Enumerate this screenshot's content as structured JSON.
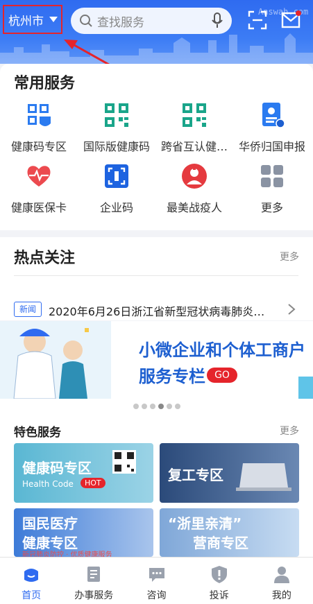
{
  "header": {
    "city": "杭州市",
    "search_placeholder": "查找服务",
    "watermark": "Answah.com"
  },
  "common_services": {
    "title": "常用服务",
    "items": [
      {
        "label": "健康码专区",
        "icon": "health-code-icon"
      },
      {
        "label": "国际版健康码",
        "icon": "qr-code-icon"
      },
      {
        "label": "跨省互认健…",
        "icon": "qr-code-icon"
      },
      {
        "label": "华侨归国申报",
        "icon": "id-card-icon"
      },
      {
        "label": "健康医保卡",
        "icon": "heart-icon"
      },
      {
        "label": "企业码",
        "icon": "enterprise-code-icon"
      },
      {
        "label": "最美战疫人",
        "icon": "medic-icon"
      },
      {
        "label": "更多",
        "icon": "grid-icon"
      }
    ]
  },
  "hot_focus": {
    "title": "热点关注",
    "more": "更多",
    "news_tag": "新闻",
    "news_title": "2020年6月26日浙江省新型冠状病毒肺炎…"
  },
  "banner": {
    "line1": "小微企业和个体工商户",
    "line2": "服务专栏",
    "go": "GO",
    "dots_total": 6,
    "dots_active_index": 3
  },
  "featured": {
    "title": "特色服务",
    "more": "更多",
    "tiles": [
      {
        "title": "健康码专区",
        "subtitle": "Health Code",
        "badge": "HOT"
      },
      {
        "title": "复工专区"
      },
      {
        "title_line1": "国民医疗",
        "title_line2": "健康专区",
        "sub": "新冠肺炎防控 · 优质健康服务"
      },
      {
        "title_line1": "“浙里亲清”",
        "title_line2": "营商专区"
      }
    ]
  },
  "tabbar": {
    "tabs": [
      {
        "label": "首页",
        "icon": "home-icon",
        "active": true
      },
      {
        "label": "办事服务",
        "icon": "document-icon",
        "active": false
      },
      {
        "label": "咨询",
        "icon": "chat-icon",
        "active": false
      },
      {
        "label": "投诉",
        "icon": "shield-icon",
        "active": false
      },
      {
        "label": "我的",
        "icon": "user-icon",
        "active": false
      }
    ]
  },
  "colors": {
    "brand_blue": "#2f6bf0",
    "alert_red": "#e5242b"
  }
}
